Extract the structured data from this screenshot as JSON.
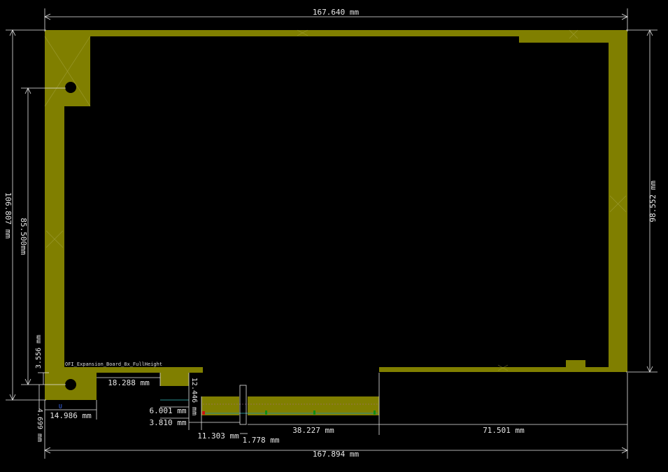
{
  "colors": {
    "background": "#000000",
    "copper": "#807f00",
    "dimension": "#e8e8e8",
    "label_small": "#dcdcdc",
    "marker_blue": "#3b6cff",
    "pad_green": "#138a13",
    "pad_red": "#c81212",
    "teal": "#2a8f8f"
  },
  "board": {
    "name": "OFI_Expansion_Board_8x_FullHeight",
    "ref_marker": "U"
  },
  "dimensions": {
    "top_width": "167.640 mm",
    "bottom_width": "167.894 mm",
    "right_height": "98.552 mm",
    "left_height": "106.807 mm",
    "inner_height": "85.500mm",
    "small_3556": "3.556 mm",
    "small_4699": "4.699 mm",
    "d_14986": "14.986 mm",
    "d_18288": "18.288 mm",
    "d_12446": "12.446 mm",
    "d_6001": "6.001 mm",
    "d_3810": "3.810 mm",
    "d_11303": "11.303 mm",
    "d_1778": "1.778 mm",
    "d_38227": "38.227 mm",
    "d_71501": "71.501 mm"
  }
}
